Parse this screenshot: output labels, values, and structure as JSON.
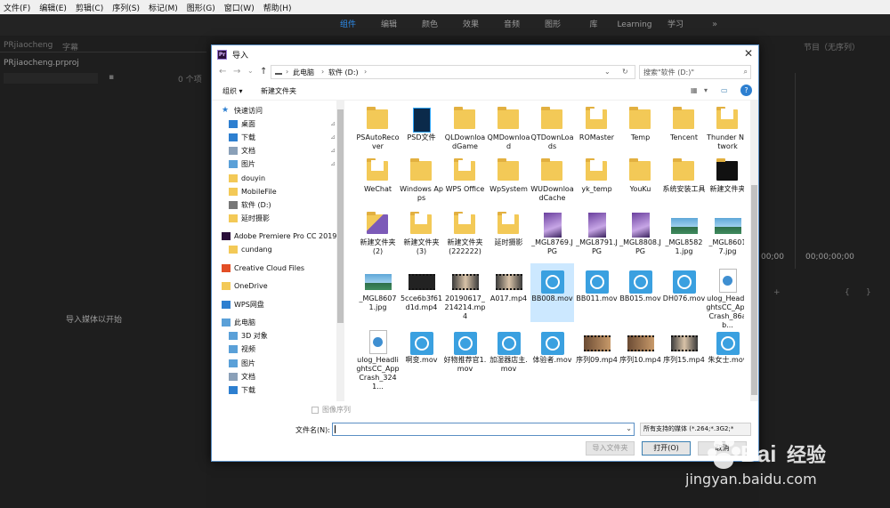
{
  "menubar": [
    "文件(F)",
    "编辑(E)",
    "剪辑(C)",
    "序列(S)",
    "标记(M)",
    "图形(G)",
    "窗口(W)",
    "帮助(H)"
  ],
  "workspace": {
    "tabs": [
      "组件",
      "编辑",
      "颜色",
      "效果",
      "音频",
      "图形",
      "库",
      "Learning",
      "学习"
    ],
    "active": 0,
    "more": "»"
  },
  "project_panel": {
    "tab1": "PRjiaocheng",
    "tab2": "字幕",
    "filename": "PRjiaocheng.prproj",
    "item_count": "0 个项",
    "empty_hint": "导入媒体以开始"
  },
  "program_panel": {
    "title": "节目（无序列）",
    "timecode_left": "00;00",
    "timecode_right": "00;00;00;00"
  },
  "dialog": {
    "title": "导入",
    "breadcrumb": [
      "此电脑",
      "软件 (D:)"
    ],
    "search_placeholder": "搜索\"软件 (D:)\"",
    "organize": "组织 ▾",
    "new_folder": "新建文件夹",
    "nav": [
      {
        "label": "快速访问",
        "icon": "star-icon",
        "pinned": false
      },
      {
        "label": "桌面",
        "icon": "desktop-icon",
        "pinned": true
      },
      {
        "label": "下载",
        "icon": "download-icon",
        "pinned": true
      },
      {
        "label": "文档",
        "icon": "document-icon",
        "pinned": true
      },
      {
        "label": "图片",
        "icon": "pictures-icon",
        "pinned": true
      },
      {
        "label": "douyin",
        "icon": "folder-icon",
        "pinned": false
      },
      {
        "label": "MobileFile",
        "icon": "folder-icon",
        "pinned": false
      },
      {
        "label": "软件 (D:)",
        "icon": "drive-icon",
        "pinned": false
      },
      {
        "label": "延时摄影",
        "icon": "folder-icon",
        "pinned": false
      },
      {
        "label": "Adobe Premiere Pro CC 2019",
        "icon": "premiere-icon",
        "pinned": false
      },
      {
        "label": "cundang",
        "icon": "folder-icon",
        "pinned": false
      },
      {
        "label": "Creative Cloud Files",
        "icon": "creative-cloud-icon",
        "pinned": false
      },
      {
        "label": "OneDrive",
        "icon": "onedrive-icon",
        "pinned": false
      },
      {
        "label": "WPS网盘",
        "icon": "wps-cloud-icon",
        "pinned": false
      },
      {
        "label": "此电脑",
        "icon": "computer-icon",
        "pinned": false
      },
      {
        "label": "3D 对象",
        "icon": "3d-objects-icon",
        "pinned": false
      },
      {
        "label": "视频",
        "icon": "videos-icon",
        "pinned": false
      },
      {
        "label": "图片",
        "icon": "pictures-icon",
        "pinned": false
      },
      {
        "label": "文档",
        "icon": "document-icon",
        "pinned": false
      },
      {
        "label": "下载",
        "icon": "download-icon",
        "pinned": false
      }
    ],
    "files": [
      {
        "name": "PSAutoRecover",
        "kind": "folder"
      },
      {
        "name": "PSD文件",
        "kind": "psd"
      },
      {
        "name": "QLDownloadGame",
        "kind": "folder"
      },
      {
        "name": "QMDownload",
        "kind": "folder"
      },
      {
        "name": "QTDownLoads",
        "kind": "folder"
      },
      {
        "name": "ROMaster",
        "kind": "folder-doc"
      },
      {
        "name": "Temp",
        "kind": "folder"
      },
      {
        "name": "Tencent",
        "kind": "folder"
      },
      {
        "name": "Thunder Network",
        "kind": "folder-doc"
      },
      {
        "name": "WeChat",
        "kind": "folder-doc"
      },
      {
        "name": "Windows Apps",
        "kind": "folder"
      },
      {
        "name": "WPS Office",
        "kind": "folder-doc"
      },
      {
        "name": "WpSystem",
        "kind": "folder"
      },
      {
        "name": "WUDownloadCache",
        "kind": "folder"
      },
      {
        "name": "yk_temp",
        "kind": "folder-doc"
      },
      {
        "name": "YouKu",
        "kind": "folder"
      },
      {
        "name": "系统安装工具",
        "kind": "folder"
      },
      {
        "name": "新建文件夹",
        "kind": "folder-dark"
      },
      {
        "name": "新建文件夹 (2)",
        "kind": "folder-purple"
      },
      {
        "name": "新建文件夹 (3)",
        "kind": "folder-doc"
      },
      {
        "name": "新建文件夹 (222222)",
        "kind": "folder-doc"
      },
      {
        "name": "延时摄影",
        "kind": "folder-doc"
      },
      {
        "name": "_MGL8769.JPG",
        "kind": "photo-purple"
      },
      {
        "name": "_MGL8791.JPG",
        "kind": "photo-purple"
      },
      {
        "name": "_MGL8808.JPG",
        "kind": "photo-purple"
      },
      {
        "name": "_MGL8582 1.jpg",
        "kind": "photo-sky"
      },
      {
        "name": "_MGL8601 7.jpg",
        "kind": "photo-sky"
      },
      {
        "name": "_MGL8607 1.jpg",
        "kind": "photo-sky"
      },
      {
        "name": "5cce6b3f61d1d.mp4",
        "kind": "film-dark"
      },
      {
        "name": "20190617_214214.mp4",
        "kind": "film-face"
      },
      {
        "name": "A017.mp4",
        "kind": "film-face"
      },
      {
        "name": "BB008.mov",
        "kind": "video",
        "selected": true
      },
      {
        "name": "BB011.mov",
        "kind": "video"
      },
      {
        "name": "BB015.mov",
        "kind": "video"
      },
      {
        "name": "DH076.mov",
        "kind": "video"
      },
      {
        "name": "ulog_HeadlightsCC_AppCrash_86ab...",
        "kind": "doc"
      },
      {
        "name": "ulog_HeadlightsCC_AppCrash_3241...",
        "kind": "doc"
      },
      {
        "name": "啊变.mov",
        "kind": "video"
      },
      {
        "name": "好物推荐官1.mov",
        "kind": "video"
      },
      {
        "name": "加湿器店主.mov",
        "kind": "video"
      },
      {
        "name": "体验者.mov",
        "kind": "video"
      },
      {
        "name": "序列09.mp4",
        "kind": "film-room"
      },
      {
        "name": "序列10.mp4",
        "kind": "film-room"
      },
      {
        "name": "序列15.mp4",
        "kind": "film-face"
      },
      {
        "name": "朱女士.mov",
        "kind": "video"
      }
    ],
    "image_sequence": "图像序列",
    "filename_label": "文件名(N):",
    "filename_value": "",
    "filetype": "所有支持的媒体 (*.264;*.3G2;*",
    "import_folder": "导入文件夹",
    "open": "打开(O)",
    "cancel": "取消"
  },
  "watermark": {
    "brand": "Bai",
    "brand_cn": "经验",
    "url": "jingyan.baidu.com"
  },
  "colors": {
    "accent": "#2d8ceb",
    "folder": "#f3c957",
    "video": "#3aa0e0",
    "selection": "#cce8ff"
  }
}
